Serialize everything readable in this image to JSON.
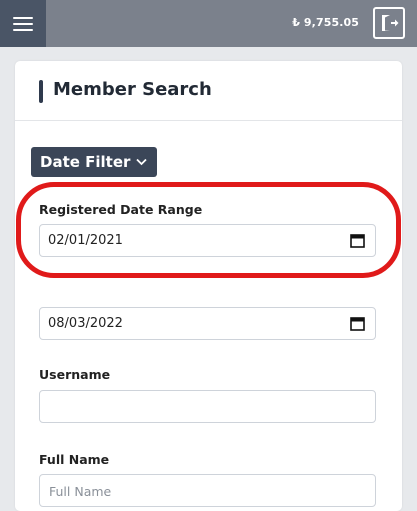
{
  "header": {
    "menu_icon": "hamburger-icon",
    "balance": "₺ 9,755.05",
    "logout_icon": "logout-icon"
  },
  "card": {
    "title": "Member Search"
  },
  "filters": {
    "date_filter_label": "Date Filter",
    "registered_range_label": "Registered Date Range",
    "start_date": "02/01/2021",
    "end_date": "08/03/2022",
    "username_label": "Username",
    "username_value": "",
    "fullname_label": "Full Name",
    "fullname_placeholder": "Full Name"
  },
  "colors": {
    "topbar": "#7b818c",
    "menu_bg": "#4a5566",
    "button_bg": "#3b4658",
    "highlight": "#e01a1a"
  }
}
